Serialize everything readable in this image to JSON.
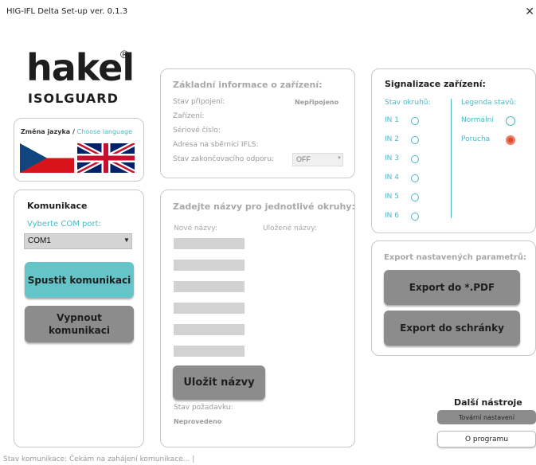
{
  "window": {
    "title": "HIG-IFL Delta Set-up  ver. 0.1.3",
    "close_glyph": "✕"
  },
  "logo": {
    "word": "hakel",
    "reg": "®",
    "sub": "ISOLGUARD"
  },
  "language": {
    "label": "Změna jazyka / ",
    "choose": "Choose language",
    "flags": [
      "czech-flag",
      "uk-flag"
    ]
  },
  "communication": {
    "title": "Komunikace",
    "com_prompt": "Vyberte COM port:",
    "com_value": "COM1",
    "start_button": "Spustit komunikaci",
    "stop_button_line1": "Vypnout",
    "stop_button_line2": "komunikaci"
  },
  "device_info": {
    "title": "Základní informace o zařízení:",
    "rows": [
      {
        "label": "Stav připojení:",
        "value": "Nepřipojeno"
      },
      {
        "label": "Zařízení:",
        "value": ""
      },
      {
        "label": "Sériové číslo:",
        "value": ""
      },
      {
        "label": "Adresa na sběrnici IFLS:",
        "value": ""
      },
      {
        "label": "Stav zakončovacího odporu:",
        "value": ""
      }
    ],
    "terminator_value": "OFF"
  },
  "names": {
    "title": "Zadejte názvy pro jednotlivé okruhy:",
    "new_label": "Nové názvy:",
    "saved_label": "Uložené názvy:",
    "save_button": "Uložit názvy",
    "request_label": "Stav požadavku:",
    "request_value": "Neprovedeno"
  },
  "signals": {
    "title": "Signalizace zařízení:",
    "circuits_label": "Stav okruhů:",
    "legend_label": "Legenda stavů:",
    "inputs": [
      "IN 1",
      "IN 2",
      "IN 3",
      "IN 4",
      "IN 5",
      "IN 6"
    ],
    "legend": [
      {
        "label": "Normální",
        "color": "#ffffff"
      },
      {
        "label": "Porucha",
        "color": "#e24a2e"
      }
    ]
  },
  "export": {
    "title": "Export nastavených parametrů:",
    "pdf_button": "Export do *.PDF",
    "clipboard_button": "Export do schránky"
  },
  "tools": {
    "title": "Další nástroje",
    "factory_button": "Tovární nastavení",
    "about_button": "O programu"
  },
  "status": {
    "text": "Stav komunikace:   Čekám na zahájení komunikace...   |"
  },
  "colors": {
    "accent": "#4db8c0",
    "start_button": "#64c4c8",
    "gray_button": "#8c8c8c",
    "fault": "#e24a2e"
  }
}
